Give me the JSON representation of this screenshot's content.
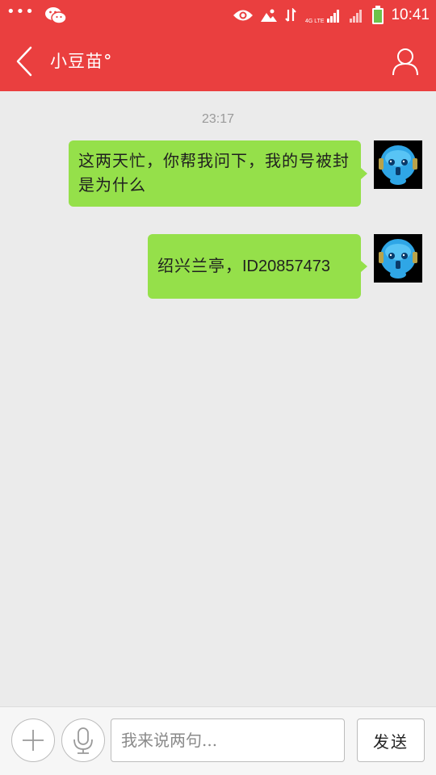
{
  "status_bar": {
    "time": "10:41",
    "icons": [
      "more-dots-icon",
      "wechat-icon",
      "eye-icon",
      "image-icon",
      "data-arrows-icon",
      "4g-lte-signal-icon",
      "signal-icon",
      "battery-icon"
    ]
  },
  "header": {
    "title": "小豆苗°",
    "back_icon": "chevron-left-icon",
    "profile_icon": "person-outline-icon"
  },
  "chat": {
    "timestamp": "23:17",
    "messages": [
      {
        "text": "这两天忙，你帮我问下，我的号被封是为什么",
        "sender": "me"
      },
      {
        "text_cn": "绍兴兰亭，",
        "text_id": "ID20857473",
        "sender": "me"
      }
    ]
  },
  "input_bar": {
    "plus_icon": "plus-icon",
    "mic_icon": "microphone-icon",
    "placeholder": "我来说两句...",
    "value": "",
    "send_label": "发送"
  },
  "colors": {
    "primary": "#ea3f3f",
    "bubble": "#95e04a",
    "background": "#ebebeb"
  }
}
